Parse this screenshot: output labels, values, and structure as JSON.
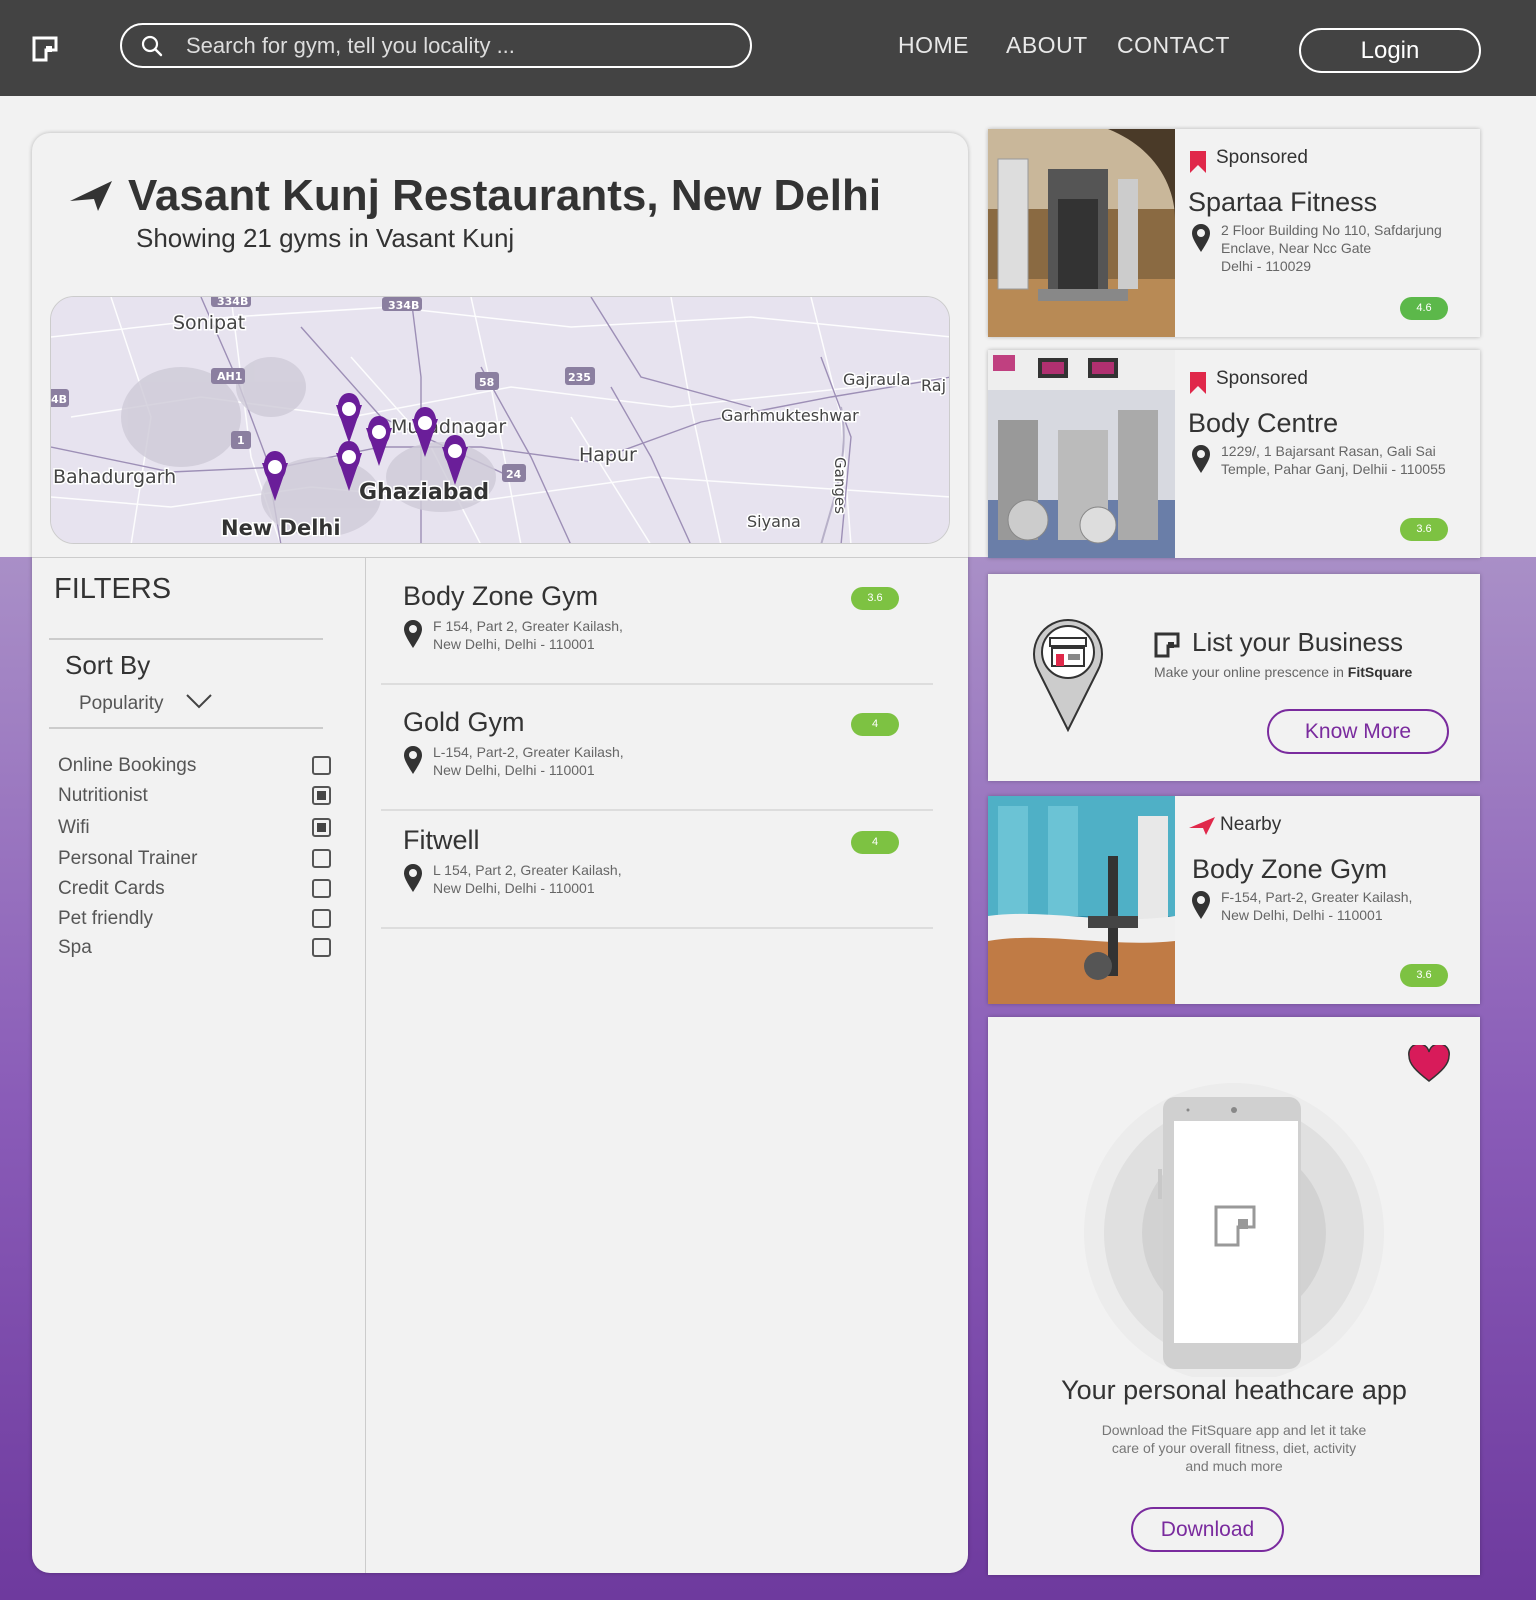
{
  "header": {
    "search_placeholder": "Search for gym, tell you locality ...",
    "nav": [
      "HOME",
      "ABOUT",
      "CONTACT"
    ],
    "login_label": "Login"
  },
  "main": {
    "title": "Vasant Kunj Restaurants, New Delhi",
    "subtitle": "Showing 21 gyms in Vasant Kunj",
    "map": {
      "places": [
        "Sonipat",
        "Bahadurgarh",
        "New Delhi",
        "Ghaziabad",
        "Muradnagar",
        "Hapur",
        "Garhmukteshwar",
        "Gajraula",
        "Raj",
        "Siyana",
        "Ganges"
      ],
      "road_badges": [
        "334B",
        "334B",
        "AH1",
        "1",
        "58",
        "235",
        "24",
        "4B"
      ]
    }
  },
  "filters": {
    "title": "FILTERS",
    "sort_label": "Sort By",
    "sort_value": "Popularity",
    "options": [
      {
        "label": "Online Bookings",
        "checked": false
      },
      {
        "label": "Nutritionist",
        "checked": true
      },
      {
        "label": "Wifi",
        "checked": true
      },
      {
        "label": "Personal Trainer",
        "checked": false
      },
      {
        "label": "Credit Cards",
        "checked": false
      },
      {
        "label": "Pet friendly",
        "checked": false
      },
      {
        "label": "Spa",
        "checked": false
      }
    ]
  },
  "gyms": [
    {
      "name": "Body Zone Gym",
      "address_line1": "F 154, Part 2, Greater Kailash,",
      "address_line2": "New Delhi, Delhi - 110001",
      "rating": "3.6"
    },
    {
      "name": "Gold Gym",
      "address_line1": "L-154, Part-2, Greater Kailash,",
      "address_line2": "New Delhi, Delhi - 110001",
      "rating": "4"
    },
    {
      "name": "Fitwell",
      "address_line1": "L 154, Part 2, Greater Kailash,",
      "address_line2": "New Delhi, Delhi - 110001",
      "rating": "4"
    }
  ],
  "sidebar": {
    "sponsored": [
      {
        "tag": "Sponsored",
        "name": "Spartaa Fitness",
        "address_line1": "2 Floor Building No 110, Safdarjung",
        "address_line2": "Enclave, Near Ncc Gate",
        "address_line3": "Delhi - 110029",
        "rating": "4.6"
      },
      {
        "tag": "Sponsored",
        "name": "Body Centre",
        "address_line1": "1229/, 1 Bajarsant Rasan, Gali Sai",
        "address_line2": "Temple, Pahar Ganj, Delhii - 110055",
        "rating": "3.6"
      }
    ],
    "business": {
      "title": "List your Business",
      "subtitle_prefix": "Make your online prescence in",
      "subtitle_brand": "FitSquare",
      "button": "Know More"
    },
    "nearby": {
      "tag": "Nearby",
      "name": "Body Zone Gym",
      "address_line1": "F-154, Part-2, Greater Kailash,",
      "address_line2": "New Delhi, Delhi - 110001",
      "rating": "3.6"
    },
    "app": {
      "title": "Your personal heathcare app",
      "desc_line1": "Download the FitSquare app and let it take",
      "desc_line2": "care of your overall fitness, diet, activity",
      "desc_line3": "and much more",
      "button": "Download"
    }
  },
  "colors": {
    "header_bg": "#434343",
    "accent_purple": "#7a2b9e",
    "rating_green": "#7dc242",
    "sponsored_red": "#e0284a",
    "heart": "#d81b5a"
  }
}
